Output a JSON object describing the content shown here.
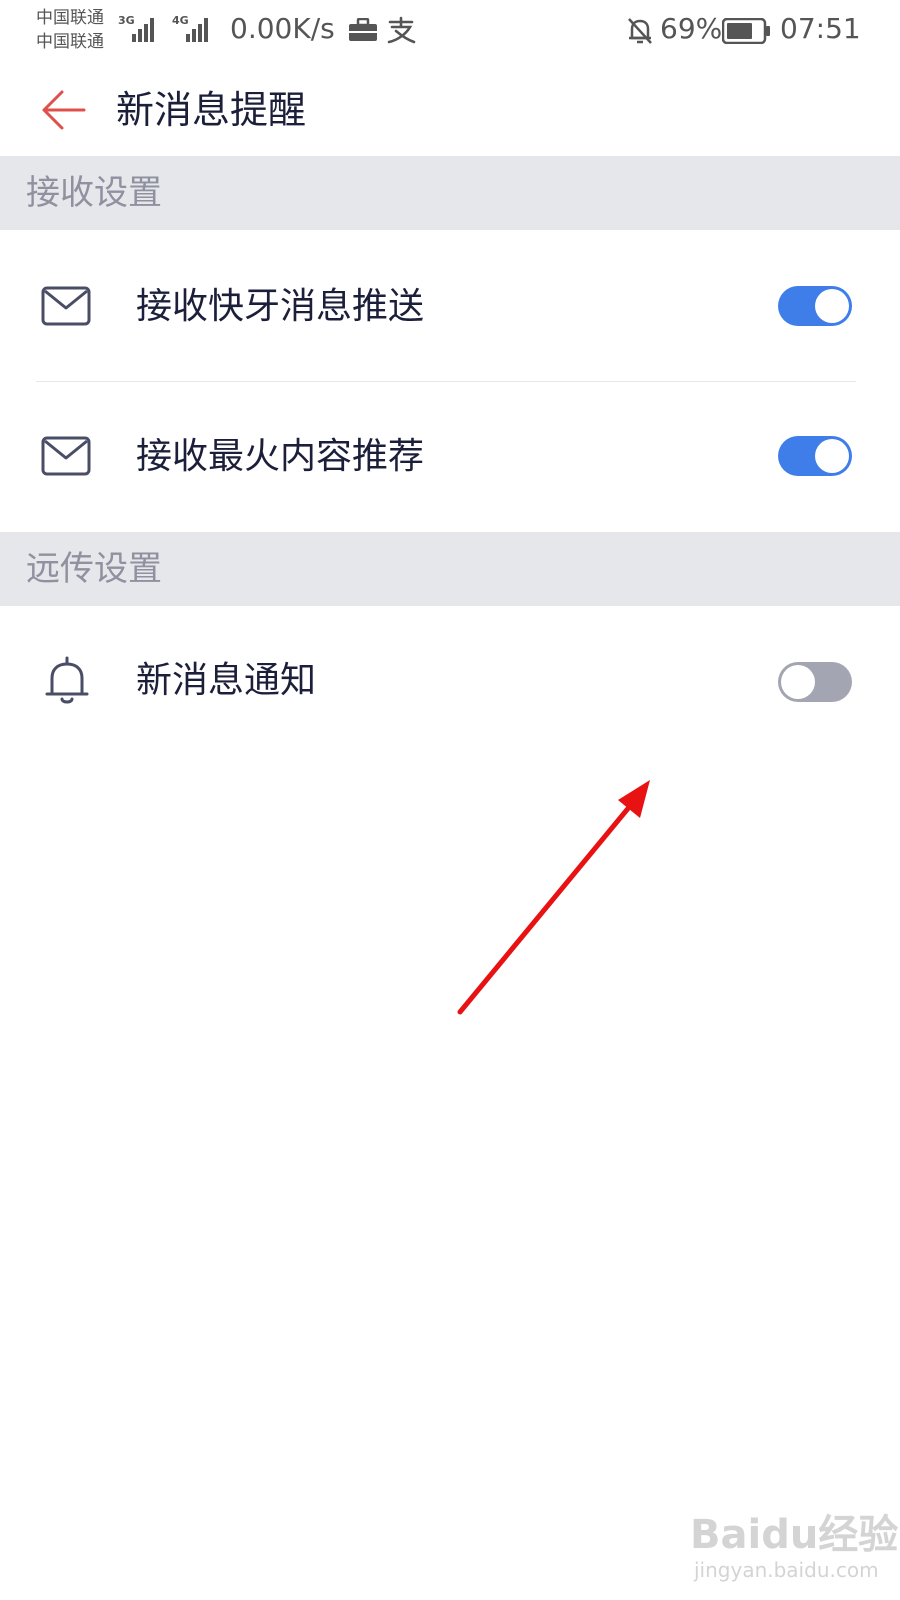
{
  "status_bar": {
    "carrier_1": "中国联通",
    "carrier_2": "中国联通",
    "network_1": "3G",
    "network_2": "4G",
    "speed": "0.00K/s",
    "battery": "69%",
    "time": "07:51"
  },
  "header": {
    "title": "新消息提醒"
  },
  "sections": [
    {
      "title": "接收设置",
      "items": [
        {
          "label": "接收快牙消息推送",
          "icon": "mail-icon",
          "enabled": true
        },
        {
          "label": "接收最火内容推荐",
          "icon": "mail-icon",
          "enabled": true
        }
      ]
    },
    {
      "title": "远传设置",
      "items": [
        {
          "label": "新消息通知",
          "icon": "bell-icon",
          "enabled": false
        }
      ]
    }
  ],
  "colors": {
    "toggle_on": "#3f7ee8",
    "toggle_off": "#a3a5b3",
    "section_bg": "#e6e7ea",
    "back_arrow": "#e0504a",
    "annotation_arrow": "#e81212"
  },
  "watermark": {
    "logo": "Baidu经验",
    "url": "jingyan.baidu.com"
  }
}
